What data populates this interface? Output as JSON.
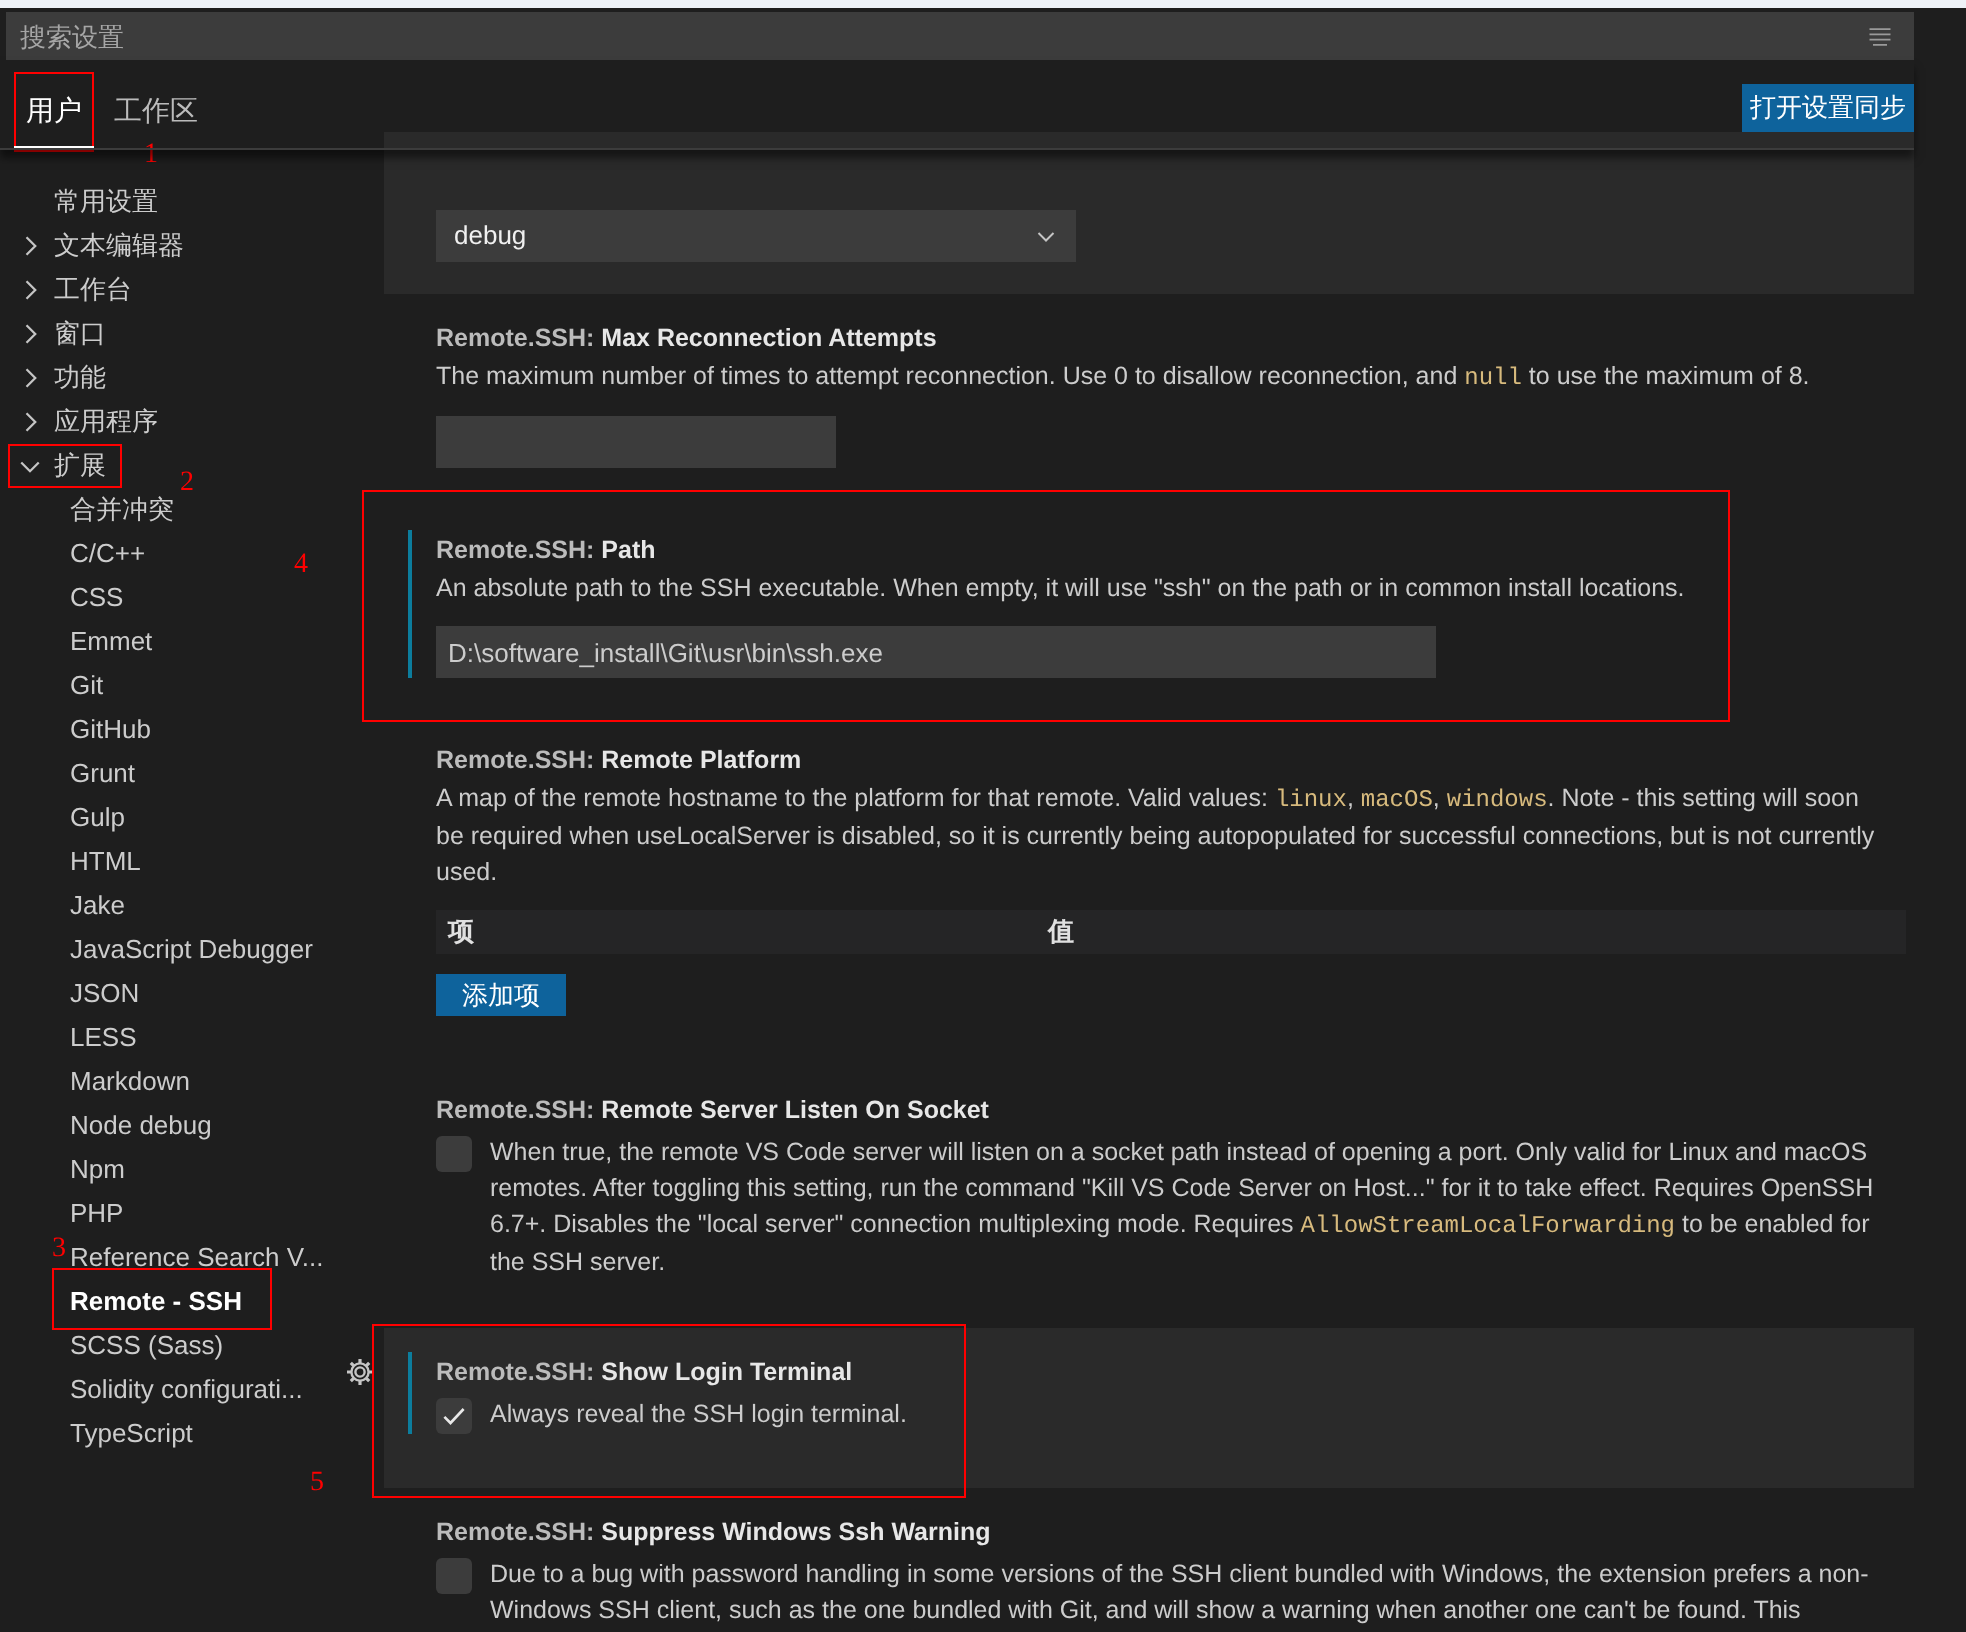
{
  "search": {
    "placeholder": "搜索设置"
  },
  "tabs": [
    {
      "label": "用户",
      "selected": true
    },
    {
      "label": "工作区",
      "selected": false
    }
  ],
  "sync_button": "打开设置同步",
  "sidebar": {
    "items": [
      {
        "label": "常用设置",
        "selected": false
      },
      {
        "label": "文本编辑器",
        "selected": false,
        "expanded": false
      },
      {
        "label": "工作台",
        "selected": false,
        "expanded": false
      },
      {
        "label": "窗口",
        "selected": false,
        "expanded": false
      },
      {
        "label": "功能",
        "selected": false,
        "expanded": false
      },
      {
        "label": "应用程序",
        "selected": false,
        "expanded": false
      },
      {
        "label": "扩展",
        "selected": false,
        "expanded": true,
        "children": [
          {
            "label": "合并冲突",
            "selected": false
          },
          {
            "label": "C/C++",
            "selected": false
          },
          {
            "label": "CSS",
            "selected": false
          },
          {
            "label": "Emmet",
            "selected": false
          },
          {
            "label": "Git",
            "selected": false
          },
          {
            "label": "GitHub",
            "selected": false
          },
          {
            "label": "Grunt",
            "selected": false
          },
          {
            "label": "Gulp",
            "selected": false
          },
          {
            "label": "HTML",
            "selected": false
          },
          {
            "label": "Jake",
            "selected": false
          },
          {
            "label": "JavaScript Debugger",
            "selected": false
          },
          {
            "label": "JSON",
            "selected": false
          },
          {
            "label": "LESS",
            "selected": false
          },
          {
            "label": "Markdown",
            "selected": false
          },
          {
            "label": "Node debug",
            "selected": false
          },
          {
            "label": "Npm",
            "selected": false
          },
          {
            "label": "PHP",
            "selected": false
          },
          {
            "label": "Reference Search V...",
            "selected": false
          },
          {
            "label": "Remote - SSH",
            "selected": true
          },
          {
            "label": "SCSS (Sass)",
            "selected": false
          },
          {
            "label": "Solidity configurati...",
            "selected": false
          },
          {
            "label": "TypeScript",
            "selected": false
          }
        ]
      }
    ]
  },
  "settings": [
    {
      "kind": "dropdown",
      "value": "debug",
      "focused": true,
      "modified": false,
      "gear": false
    },
    {
      "kind": "number",
      "category": "Remote.SSH: ",
      "title": "Max Reconnection Attempts",
      "focused": false,
      "modified": false,
      "gear": false,
      "description": [
        {
          "kind": "text",
          "text": "The maximum number of times to attempt reconnection. Use 0 to disallow reconnection, and "
        },
        {
          "kind": "code",
          "text": "null"
        },
        {
          "kind": "text",
          "text": " to use the maximum of 8."
        }
      ]
    },
    {
      "kind": "text",
      "category": "Remote.SSH: ",
      "title": "Path",
      "focused": false,
      "modified": true,
      "gear": false,
      "value": "D:\\software_install\\Git\\usr\\bin\\ssh.exe",
      "description": [
        {
          "kind": "text",
          "text": "An absolute path to the SSH executable. When empty, it will use \"ssh\" on the path or in common install locations."
        }
      ]
    },
    {
      "kind": "object",
      "category": "Remote.SSH: ",
      "title": "Remote Platform",
      "focused": false,
      "modified": false,
      "gear": false,
      "columns": [
        "项",
        "值"
      ],
      "add_button": "添加项",
      "description": [
        {
          "kind": "text",
          "text": "A map of the remote hostname to the platform for that remote. Valid values: "
        },
        {
          "kind": "code",
          "text": "linux"
        },
        {
          "kind": "text",
          "text": ", "
        },
        {
          "kind": "code",
          "text": "macOS"
        },
        {
          "kind": "text",
          "text": ", "
        },
        {
          "kind": "code",
          "text": "windows"
        },
        {
          "kind": "text",
          "text": ". Note - this setting will soon be required when useLocalServer is disabled, so it is currently being autopopulated for successful connections, but is not currently used."
        }
      ]
    },
    {
      "kind": "checkbox",
      "category": "Remote.SSH: ",
      "title": "Remote Server Listen On Socket",
      "focused": false,
      "modified": false,
      "gear": false,
      "checked": false,
      "description": [
        {
          "kind": "text",
          "text": "When true, the remote VS Code server will listen on a socket path instead of opening a port. Only valid for Linux and macOS remotes. After toggling this setting, run the command \"Kill VS Code Server on Host...\" for it to take effect. Requires OpenSSH 6.7+. Disables the \"local server\" connection multiplexing mode. Requires "
        },
        {
          "kind": "code",
          "text": "AllowStreamLocalForwarding"
        },
        {
          "kind": "text",
          "text": " to be enabled for the SSH server."
        }
      ]
    },
    {
      "kind": "checkbox",
      "category": "Remote.SSH: ",
      "title": "Show Login Terminal",
      "focused": true,
      "modified": true,
      "gear": true,
      "checked": true,
      "description": [
        {
          "kind": "text",
          "text": "Always reveal the SSH login terminal."
        }
      ]
    },
    {
      "kind": "checkbox",
      "category": "Remote.SSH: ",
      "title": "Suppress Windows Ssh Warning",
      "focused": false,
      "modified": false,
      "gear": false,
      "checked": false,
      "description": [
        {
          "kind": "text",
          "text": "Due to a bug with password handling in some versions of the SSH client bundled with Windows, the extension prefers a non-Windows SSH client, such as the one bundled with Git, and will show a warning when another one can't be found. This"
        }
      ]
    }
  ],
  "annotations": [
    {
      "label": "1"
    },
    {
      "label": "2"
    },
    {
      "label": "3"
    },
    {
      "label": "4"
    },
    {
      "label": "5"
    }
  ]
}
